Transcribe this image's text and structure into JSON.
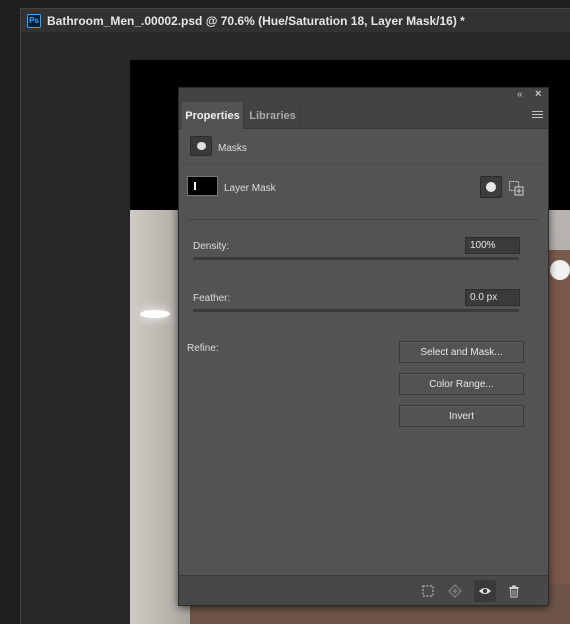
{
  "app": {
    "icon_label": "Ps",
    "accent": "#31a8ff"
  },
  "document": {
    "title": "Bathroom_Men_.00002.psd @ 70.6% (Hue/Saturation 18, Layer Mask/16) *"
  },
  "panel": {
    "tabs": [
      {
        "label": "Properties",
        "active": true
      },
      {
        "label": "Libraries",
        "active": false
      }
    ],
    "section_label": "Masks",
    "layer_mask_label": "Layer Mask",
    "density": {
      "label": "Density:",
      "value": "100%",
      "fraction": 1.0
    },
    "feather": {
      "label": "Feather:",
      "value": "0.0 px",
      "fraction": 0.0
    },
    "refine": {
      "label": "Refine:",
      "buttons": [
        "Select and Mask...",
        "Color Range...",
        "Invert"
      ]
    },
    "bottom_icons": [
      "load-selection-icon",
      "apply-mask-icon",
      "visibility-eye-icon",
      "delete-mask-icon"
    ]
  }
}
